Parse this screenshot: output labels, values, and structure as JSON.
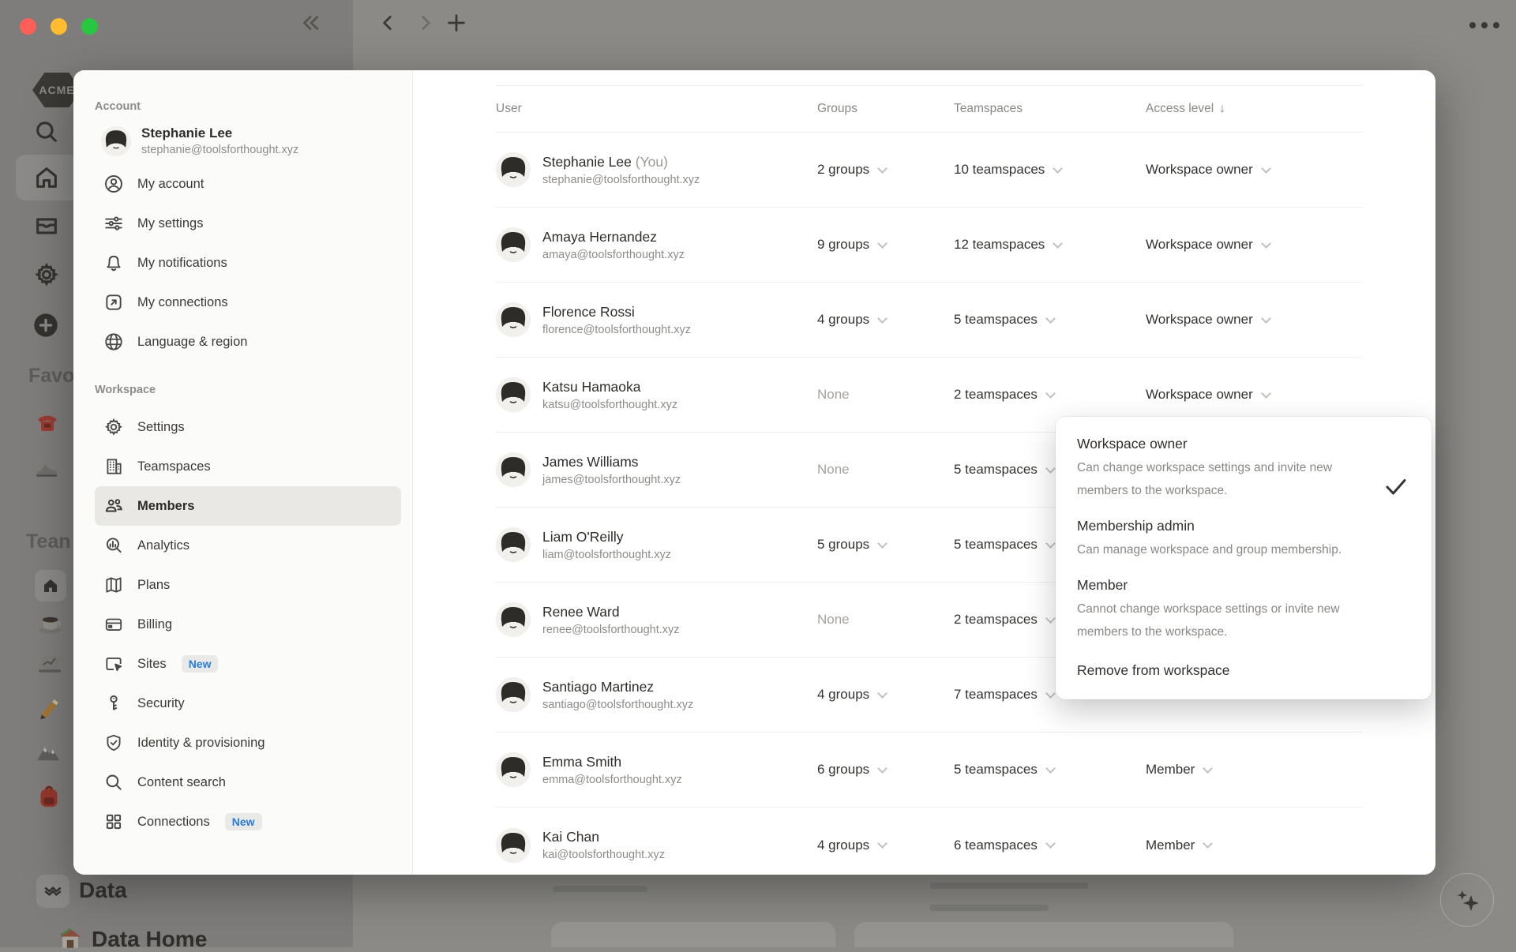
{
  "bg_sidebar": {
    "logo_text": "ACME",
    "favorites_label": "Favo",
    "teamspaces_label": "Tean",
    "data_label": "Data",
    "data_home_label": "Data Home"
  },
  "modal": {
    "nav": {
      "account_section": "Account",
      "profile": {
        "name": "Stephanie Lee",
        "email": "stephanie@toolsforthought.xyz"
      },
      "account_items": [
        {
          "label": "My account"
        },
        {
          "label": "My settings"
        },
        {
          "label": "My notifications"
        },
        {
          "label": "My connections"
        },
        {
          "label": "Language & region"
        }
      ],
      "workspace_section": "Workspace",
      "workspace_items": [
        {
          "label": "Settings"
        },
        {
          "label": "Teamspaces"
        },
        {
          "label": "Members",
          "selected": true
        },
        {
          "label": "Analytics"
        },
        {
          "label": "Plans"
        },
        {
          "label": "Billing"
        },
        {
          "label": "Sites",
          "badge": "New"
        },
        {
          "label": "Security"
        },
        {
          "label": "Identity & provisioning"
        },
        {
          "label": "Content search"
        },
        {
          "label": "Connections",
          "badge": "New"
        }
      ]
    },
    "table": {
      "columns": {
        "user": "User",
        "groups": "Groups",
        "teamspaces": "Teamspaces",
        "access": "Access level",
        "sort_icon": "↓"
      },
      "rows": [
        {
          "name": "Stephanie Lee",
          "you": "(You)",
          "email": "stephanie@toolsforthought.xyz",
          "groups": "2 groups",
          "teamspaces": "10 teamspaces",
          "access": "Workspace owner"
        },
        {
          "name": "Amaya Hernandez",
          "email": "amaya@toolsforthought.xyz",
          "groups": "9 groups",
          "teamspaces": "12 teamspaces",
          "access": "Workspace owner"
        },
        {
          "name": "Florence Rossi",
          "email": "florence@toolsforthought.xyz",
          "groups": "4 groups",
          "teamspaces": "5 teamspaces",
          "access": "Workspace owner"
        },
        {
          "name": "Katsu Hamaoka",
          "email": "katsu@toolsforthought.xyz",
          "groups": "None",
          "teamspaces": "2 teamspaces",
          "access": "Workspace owner"
        },
        {
          "name": "James Williams",
          "email": "james@toolsforthought.xyz",
          "groups": "None",
          "teamspaces": "5 teamspaces",
          "access": ""
        },
        {
          "name": "Liam O'Reilly",
          "email": "liam@toolsforthought.xyz",
          "groups": "5 groups",
          "teamspaces": "5 teamspaces",
          "access": ""
        },
        {
          "name": "Renee Ward",
          "email": "renee@toolsforthought.xyz",
          "groups": "None",
          "teamspaces": "2 teamspaces",
          "access": ""
        },
        {
          "name": "Santiago Martinez",
          "email": "santiago@toolsforthought.xyz",
          "groups": "4 groups",
          "teamspaces": "7 teamspaces",
          "access": ""
        },
        {
          "name": "Emma Smith",
          "email": "emma@toolsforthought.xyz",
          "groups": "6 groups",
          "teamspaces": "5 teamspaces",
          "access": "Member"
        },
        {
          "name": "Kai Chan",
          "email": "kai@toolsforthought.xyz",
          "groups": "4 groups",
          "teamspaces": "6 teamspaces",
          "access": "Member"
        }
      ]
    },
    "popup": {
      "options": [
        {
          "title": "Workspace owner",
          "desc": "Can change workspace settings and invite new members to the workspace.",
          "checked": true
        },
        {
          "title": "Membership admin",
          "desc": "Can manage workspace and group membership.",
          "checked": false
        },
        {
          "title": "Member",
          "desc": "Cannot change workspace settings or invite new members to the workspace.",
          "checked": false
        }
      ],
      "action": "Remove from workspace"
    }
  }
}
